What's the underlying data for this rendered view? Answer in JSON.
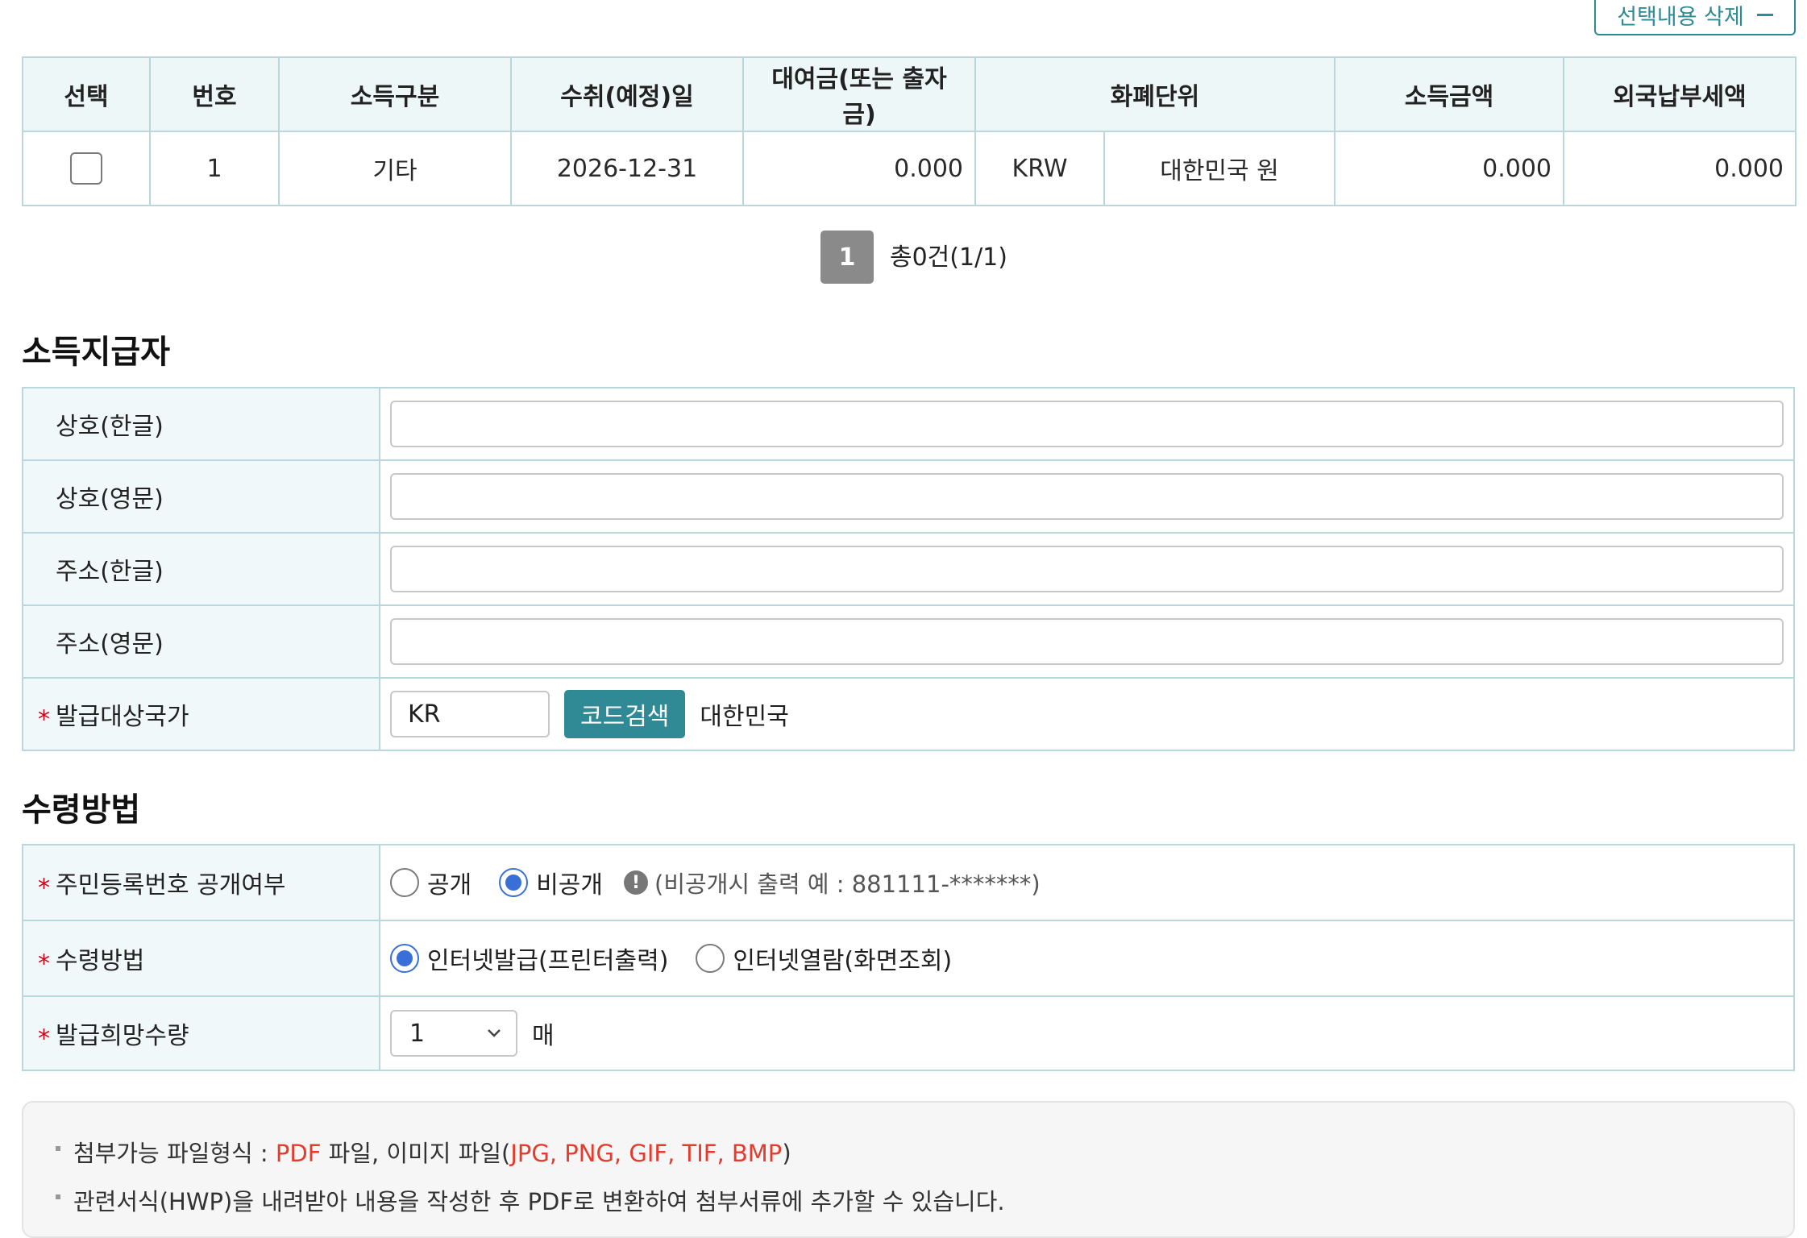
{
  "toolbar": {
    "delete_selected_label": "선택내용 삭제"
  },
  "table": {
    "headers": [
      "선택",
      "번호",
      "소득구분",
      "수취(예정)일",
      "대여금(또는 출자금)",
      "화폐단위",
      "소득금액",
      "외국납부세액"
    ],
    "rows": [
      {
        "no": "1",
        "income_type": "기타",
        "date": "2026-12-31",
        "loan": "0.000",
        "currency_code": "KRW",
        "currency_name": "대한민국 원",
        "income_amount": "0.000",
        "foreign_tax": "0.000"
      }
    ]
  },
  "pagination": {
    "current_page": "1",
    "total_text": "총0건(1/1)"
  },
  "payer": {
    "title": "소득지급자",
    "labels": {
      "name_kr": "상호(한글)",
      "name_en": "상호(영문)",
      "addr_kr": "주소(한글)",
      "addr_en": "주소(영문)",
      "country": "발급대상국가"
    },
    "country_code": "KR",
    "code_search_label": "코드검색",
    "country_name": "대한민국"
  },
  "receipt": {
    "title": "수령방법",
    "rrn_label": "주민등록번호 공개여부",
    "rrn_public": "공개",
    "rrn_private": "비공개",
    "rrn_hint": "(비공개시 출력 예 : 881111-*******)",
    "method_label": "수령방법",
    "method_internet_issue": "인터넷발급(프린터출력)",
    "method_internet_view": "인터넷열람(화면조회)",
    "qty_label": "발급희망수량",
    "qty_value": "1",
    "qty_unit": "매"
  },
  "notice": {
    "line1_prefix": "첨부가능 파일형식 : ",
    "line1_pdf": "PDF",
    "line1_mid": " 파일, 이미지 파일(",
    "line1_images": "JPG, PNG, GIF, TIF, BMP",
    "line1_suffix": ")",
    "line2": "관련서식(HWP)을 내려받아 내용을 작성한 후 PDF로 변환하여 첨부서류에 추가할 수 있습니다."
  },
  "colors": {
    "accent": "#2f8a95",
    "required": "#d0021b",
    "radio_on": "#3a6fd8",
    "highlight": "#e53b2c"
  }
}
